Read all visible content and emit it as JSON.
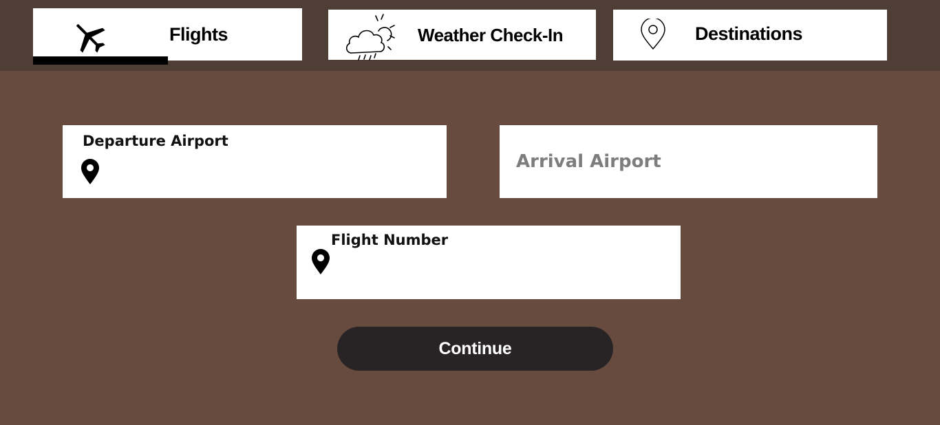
{
  "tabs": {
    "flights": {
      "label": "Flights",
      "icon": "airplane-icon",
      "selected": true
    },
    "weather": {
      "label": "Weather Check-In",
      "icon": "cloud-rain-sun-icon",
      "selected": false
    },
    "destinations": {
      "label": "Destinations",
      "icon": "location-pin-outline-icon",
      "selected": false
    }
  },
  "form": {
    "departure": {
      "label": "Departure Airport",
      "value": "",
      "icon": "location-pin-icon"
    },
    "arrival": {
      "placeholder": "Arrival Airport",
      "value": ""
    },
    "flight_number": {
      "label": "Flight Number",
      "value": "",
      "icon": "location-pin-icon"
    },
    "continue_label": "Continue"
  },
  "colors": {
    "background": "#674b3e",
    "topbar": "#4e3e35",
    "button": "#282425",
    "tab_underline": "#000000"
  }
}
